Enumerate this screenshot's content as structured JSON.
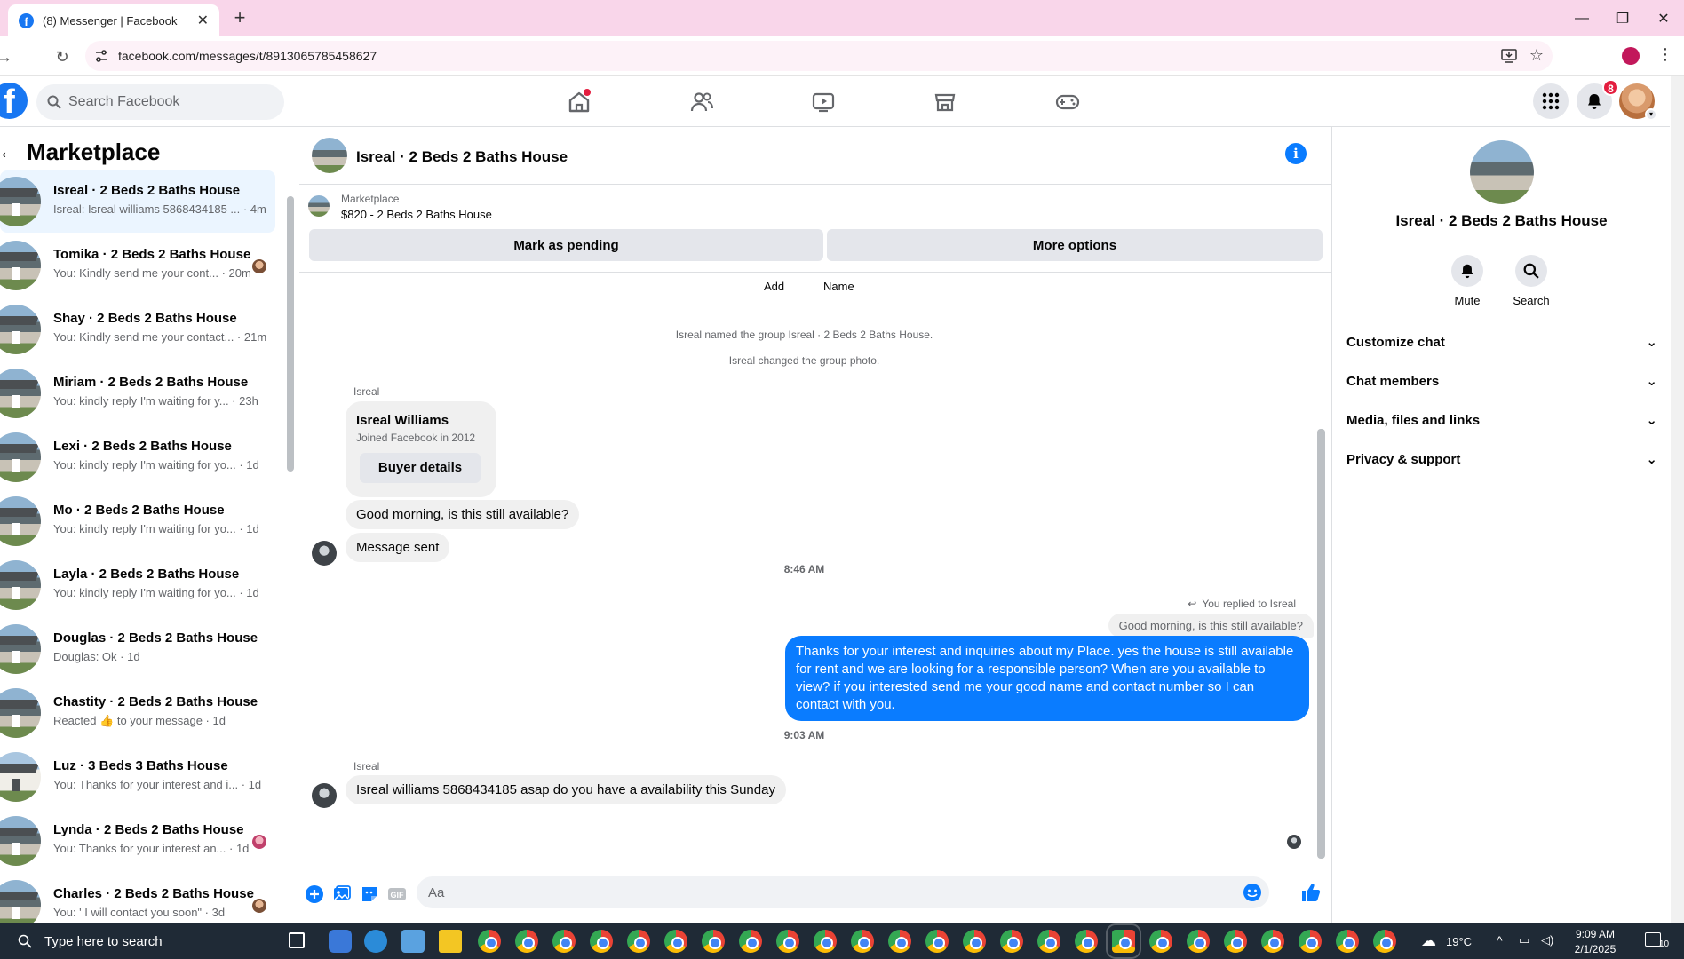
{
  "browser": {
    "tab_title": "(8) Messenger | Facebook",
    "url": "facebook.com/messages/t/8913065785458627"
  },
  "fb_header": {
    "search_placeholder": "Search Facebook",
    "notifications_count": "8"
  },
  "left": {
    "title": "Marketplace",
    "conversations": [
      {
        "name": "Isreal · 2 Beds 2 Baths House",
        "snippet": "Isreal: Isreal williams 5868434185 ... · 4m"
      },
      {
        "name": "Tomika · 2 Beds 2 Baths House",
        "snippet": "You: Kindly send me your cont... · 20m"
      },
      {
        "name": "Shay · 2 Beds 2 Baths House",
        "snippet": "You: Kindly send me your contact... · 21m"
      },
      {
        "name": "Miriam · 2 Beds 2 Baths House",
        "snippet": "You: kindly reply I'm waiting for y... · 23h"
      },
      {
        "name": "Lexi · 2 Beds 2 Baths House",
        "snippet": "You: kindly reply I'm waiting for yo... · 1d"
      },
      {
        "name": "Mo · 2 Beds 2 Baths House",
        "snippet": "You: kindly reply I'm waiting for yo... · 1d"
      },
      {
        "name": "Layla · 2 Beds 2 Baths House",
        "snippet": "You: kindly reply I'm waiting for yo... · 1d"
      },
      {
        "name": "Douglas · 2 Beds 2 Baths House",
        "snippet": "Douglas: Ok · 1d"
      },
      {
        "name": "Chastity · 2 Beds 2 Baths House",
        "snippet": "Reacted 👍 to your message · 1d"
      },
      {
        "name": "Luz · 3 Beds 3 Baths House",
        "snippet": "You: Thanks for your interest and i... · 1d"
      },
      {
        "name": "Lynda · 2 Beds 2 Baths House",
        "snippet": "You: Thanks for your interest an... · 1d"
      },
      {
        "name": "Charles · 2 Beds 2 Baths House",
        "snippet": "You: ' I will contact you soon\" · 3d"
      }
    ]
  },
  "conversation": {
    "title": "Isreal · 2 Beds 2 Baths House",
    "listing_label": "Marketplace",
    "listing_price": "$820 - 2 Beds 2 Baths House",
    "mark_pending": "Mark as pending",
    "more_options": "More options",
    "add_label": "Add",
    "name_label": "Name",
    "system1": "Isreal named the group Isreal · 2 Beds 2 Baths House.",
    "system2": "Isreal changed the group photo.",
    "sender_name": "Isreal",
    "profile_name": "Isreal Williams",
    "profile_joined": "Joined Facebook in 2012",
    "buyer_details": "Buyer details",
    "msg1": "Good morning, is this still available?",
    "msg2": "Message sent",
    "time1": "8:46 AM",
    "replied_label": "You replied to Isreal",
    "quoted": "Good morning, is this still available?",
    "reply": "Thanks for your interest and inquiries about my Place. yes the house is still available for rent and we are looking for a responsible person? When are you available to view? if you interested send me your good name and contact number  so I can contact with you.",
    "time2": "9:03 AM",
    "msg3": "Isreal williams 5868434185 asap do you have a availability this Sunday",
    "composer_placeholder": "Aa"
  },
  "right": {
    "name": "Isreal · 2 Beds 2 Baths House",
    "mute": "Mute",
    "search": "Search",
    "sections": [
      "Customize chat",
      "Chat members",
      "Media, files and links",
      "Privacy & support"
    ]
  },
  "taskbar": {
    "search_text": "Type here to search",
    "weather": "19°C",
    "time": "9:09 AM",
    "date": "2/1/2025",
    "notif_count": "10"
  },
  "colors": {
    "fb_blue": "#1877f2",
    "messenger_blue": "#0a7cff",
    "tab_strip": "#f9d6ea"
  }
}
